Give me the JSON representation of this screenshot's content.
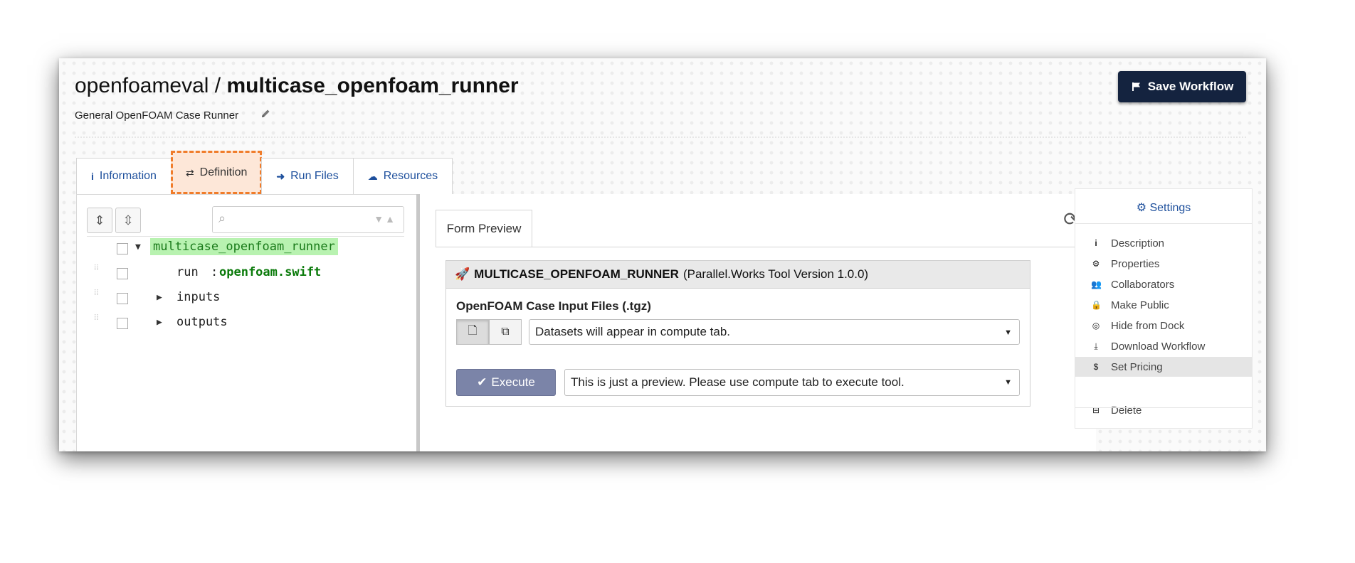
{
  "header": {
    "owner": "openfoameval",
    "separator": " / ",
    "workflow": "multicase_openfoam_runner",
    "subtitle": "General OpenFOAM Case Runner",
    "save_label": "Save Workflow"
  },
  "tabs": [
    {
      "label": "Information",
      "icon": "info-icon"
    },
    {
      "label": "Definition",
      "icon": "retweet-icon",
      "active": true
    },
    {
      "label": "Run Files",
      "icon": "arrow-right-icon"
    },
    {
      "label": "Resources",
      "icon": "cloud-icon"
    }
  ],
  "tree": {
    "root": "multicase_openfoam_runner",
    "run_key": "run",
    "run_sep": ":",
    "run_value": "openfoam.swift",
    "inputs": "inputs",
    "outputs": "outputs"
  },
  "form": {
    "tab_label": "Form Preview",
    "tool_name": "MULTICASE_OPENFOAM_RUNNER",
    "tool_version": "(Parallel.Works Tool Version 1.0.0)",
    "field_label": "OpenFOAM Case Input Files (.tgz)",
    "dataset_select": "Datasets will appear in compute tab.",
    "execute_label": "Execute",
    "execute_select": "This is just a preview. Please use compute tab to execute tool."
  },
  "settings": {
    "title": "Settings",
    "items": [
      {
        "label": "Description",
        "icon": "info-icon"
      },
      {
        "label": "Properties",
        "icon": "gear-icon"
      },
      {
        "label": "Collaborators",
        "icon": "users-icon"
      },
      {
        "label": "Make Public",
        "icon": "lock-icon"
      },
      {
        "label": "Hide from Dock",
        "icon": "eye-slash-icon"
      },
      {
        "label": "Download Workflow",
        "icon": "download-icon"
      },
      {
        "label": "Set Pricing",
        "icon": "dollar-icon",
        "highlighted": true
      },
      {
        "label": "Delete",
        "icon": "minus-square-icon"
      }
    ]
  },
  "colors": {
    "save_button": "#14233f",
    "active_tab_bg": "#fde7d8",
    "active_tab_outline": "#f07c2a",
    "link": "#1d4f9c",
    "root_highlight": "#b8f2b0",
    "execute_button": "#7b84a8"
  }
}
